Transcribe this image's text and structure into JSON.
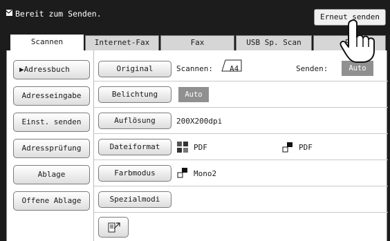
{
  "status": {
    "message": "Bereit zum Senden.",
    "resend_label": "Erneut senden"
  },
  "tabs": [
    {
      "label": "Scannen",
      "active": true
    },
    {
      "label": "Internet-Fax",
      "active": false
    },
    {
      "label": "Fax",
      "active": false
    },
    {
      "label": "USB Sp. Scan",
      "active": false
    },
    {
      "label": "PC",
      "active": false
    }
  ],
  "sidebar": {
    "items": [
      {
        "label": "▶Adressbuch"
      },
      {
        "label": "Adresseingabe"
      },
      {
        "label": "Einst. senden"
      },
      {
        "label": "Adressprüfung"
      },
      {
        "label": "Ablage"
      },
      {
        "label": "Offene Ablage"
      }
    ]
  },
  "settings": {
    "original": {
      "label": "Original",
      "scan_label": "Scannen:",
      "scan_value": "A4",
      "send_label": "Senden:",
      "send_value": "Auto"
    },
    "exposure": {
      "label": "Belichtung",
      "value": "Auto"
    },
    "resolution": {
      "label": "Auflösung",
      "value": "200X200dpi"
    },
    "file_format": {
      "label": "Dateiformat",
      "value_color": "PDF",
      "value_mono": "PDF"
    },
    "color_mode": {
      "label": "Farbmodus",
      "value": "Mono2"
    },
    "special": {
      "label": "Spezialmodi"
    }
  },
  "colors": {
    "status_bar": "#1c1c1c",
    "auto_badge": "#909090"
  }
}
